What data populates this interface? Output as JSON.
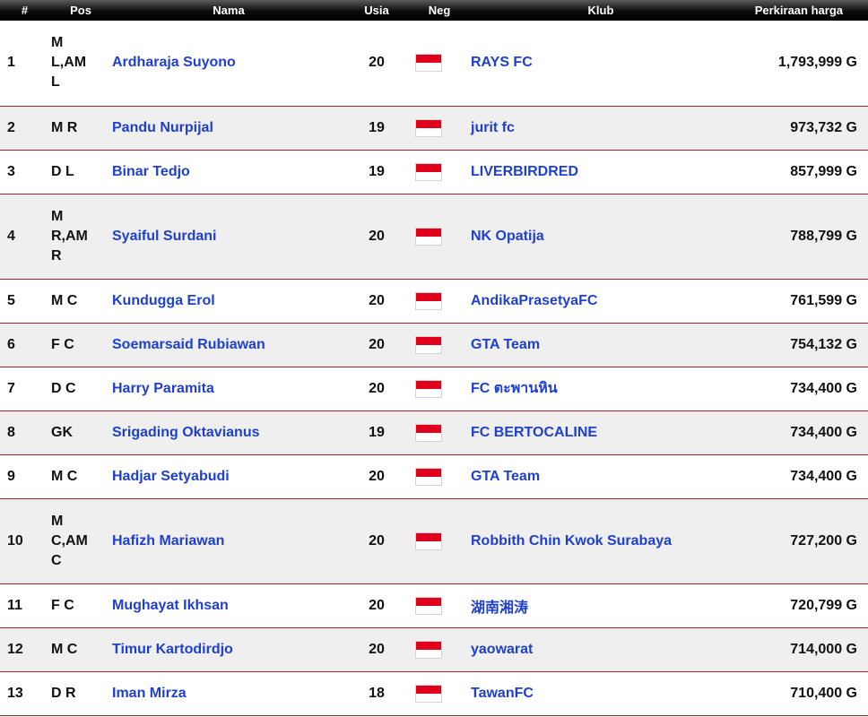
{
  "table": {
    "headers": {
      "rank": "#",
      "pos": "Pos",
      "name": "Nama",
      "age": "Usia",
      "country": "Neg",
      "club": "Klub",
      "price": "Perkiraan harga"
    },
    "flag_colors": {
      "top": "#e0001b",
      "bottom": "#ffffff"
    },
    "flag_icon": "indonesia-flag-icon",
    "rows": [
      {
        "rank": "1",
        "pos": "M L,AM L",
        "name": "Ardharaja Suyono",
        "age": "20",
        "club": "RAYS FC",
        "price": "1,793,999 G"
      },
      {
        "rank": "2",
        "pos": "M R",
        "name": "Pandu Nurpijal",
        "age": "19",
        "club": "jurit fc",
        "price": "973,732 G"
      },
      {
        "rank": "3",
        "pos": "D L",
        "name": "Binar Tedjo",
        "age": "19",
        "club": "LIVERBIRDRED",
        "price": "857,999 G"
      },
      {
        "rank": "4",
        "pos": "M R,AM R",
        "name": "Syaiful Surdani",
        "age": "20",
        "club": "NK Opatija",
        "price": "788,799 G"
      },
      {
        "rank": "5",
        "pos": "M C",
        "name": "Kundugga Erol",
        "age": "20",
        "club": "AndikaPrasetyaFC",
        "price": "761,599 G"
      },
      {
        "rank": "6",
        "pos": "F C",
        "name": "Soemarsaid Rubiawan",
        "age": "20",
        "club": "GTA Team",
        "price": "754,132 G"
      },
      {
        "rank": "7",
        "pos": "D C",
        "name": "Harry Paramita",
        "age": "20",
        "club": "FC ตะพานหิน",
        "price": "734,400 G"
      },
      {
        "rank": "8",
        "pos": "GK",
        "name": "Srigading Oktavianus",
        "age": "19",
        "club": "FC BERTOCALINE",
        "price": "734,400 G"
      },
      {
        "rank": "9",
        "pos": "M C",
        "name": "Hadjar Setyabudi",
        "age": "20",
        "club": "GTA Team",
        "price": "734,400 G"
      },
      {
        "rank": "10",
        "pos": "M C,AM C",
        "name": "Hafizh Mariawan",
        "age": "20",
        "club": "Robbith Chin Kwok Surabaya",
        "price": "727,200 G"
      },
      {
        "rank": "11",
        "pos": "F C",
        "name": "Mughayat Ikhsan",
        "age": "20",
        "club": "湖南湘涛",
        "price": "720,799 G"
      },
      {
        "rank": "12",
        "pos": "M C",
        "name": "Timur Kartodirdjo",
        "age": "20",
        "club": "yaowarat",
        "price": "714,000 G"
      },
      {
        "rank": "13",
        "pos": "D R",
        "name": "Iman Mirza",
        "age": "18",
        "club": "TawanFC",
        "price": "710,400 G"
      }
    ]
  }
}
